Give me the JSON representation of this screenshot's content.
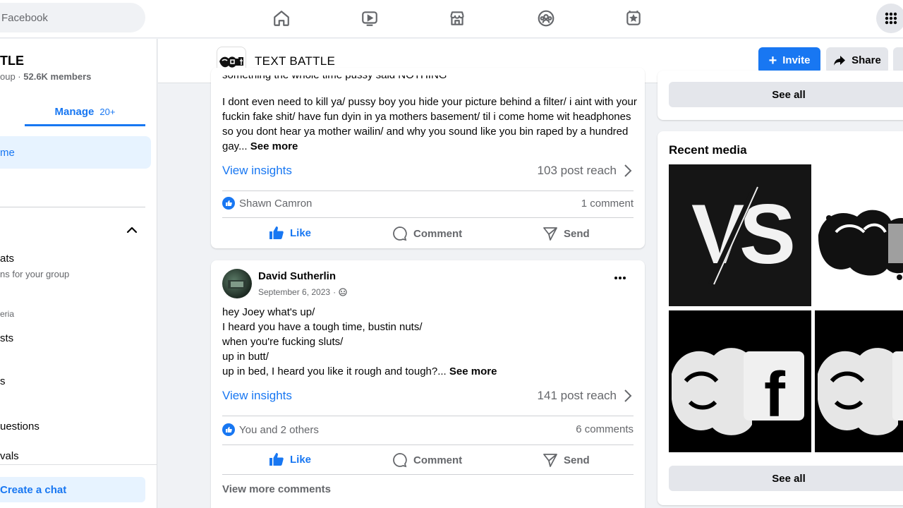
{
  "topbar": {
    "search_placeholder": "Facebook",
    "nav_icons": [
      "home-icon",
      "video-icon",
      "marketplace-icon",
      "groups-icon",
      "gaming-icon"
    ],
    "apps_icon": "menu-grid-icon"
  },
  "sidebar": {
    "group_title": "TLE",
    "group_type_suffix": "oup · ",
    "members": "52.6K members",
    "manage_tab": "Manage",
    "manage_count": "20+",
    "home_item": "me",
    "stats_item": "ats",
    "stats_desc": "ns for your group",
    "section_label": "eria",
    "posts_item": "sts",
    "s_item": "s",
    "questions_item": "uestions",
    "approvals_item": "vals",
    "create_chat": "Create a chat"
  },
  "group_header": {
    "title": "TEXT BATTLE",
    "invite_label": "Invite",
    "share_label": "Share"
  },
  "post1": {
    "truncated_line": "something the whole time pussy said NOTHING",
    "text": "I dont even need to kill ya/ pussy boy you hide your picture behind a filter/ i aint with your fuckin fake shit/ have fun dyin in ya mothers basement/ til i come home wit headphones so you dont hear ya mother wailin/ and why you sound like you bin raped by a hundred gay...",
    "see_more": "See more",
    "insights": "View insights",
    "reach": "103 post reach",
    "reactors": "Shawn Camron",
    "comments": "1 comment",
    "like": "Like",
    "comment": "Comment",
    "send": "Send"
  },
  "post2": {
    "author": "David Sutherlin",
    "date": "September 6, 2023",
    "lines": [
      "hey Joey what's up/",
      "I heard you have a tough time, bustin nuts/",
      "when you're fucking sluts/",
      "up in butt/",
      "up in bed, I heard you like it rough and tough?..."
    ],
    "see_more": "See more",
    "insights": "View insights",
    "reach": "141 post reach",
    "reactors": "You and 2 others",
    "comments": "6 comments",
    "like": "Like",
    "comment": "Comment",
    "send": "Send",
    "view_more_comments": "View more comments"
  },
  "right": {
    "see_all_top": "See all",
    "recent_media_title": "Recent media",
    "see_all_bottom": "See all",
    "media_tile_letters": [
      "VS",
      "f"
    ]
  },
  "colors": {
    "accent": "#1877f2",
    "bg": "#f0f2f5"
  }
}
